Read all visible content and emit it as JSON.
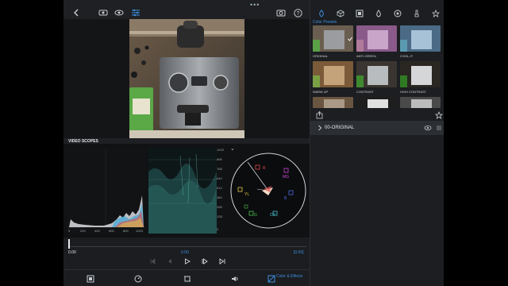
{
  "window": {
    "dots": "•••"
  },
  "toolbar": {
    "back_icon": "chevron-left-icon",
    "icons": [
      "viewer-icon",
      "eye-icon",
      "sliders-icon"
    ],
    "right_icons": [
      "camera-icon",
      "help-icon"
    ]
  },
  "scopes": {
    "label": "VIDEO SCOPES",
    "histogram_axis": [
      "0",
      "200",
      "400",
      "600",
      "800",
      "1023"
    ],
    "waveform_scale": [
      "1023",
      "896",
      "768",
      "640",
      "512",
      "384",
      "256",
      "128",
      "0"
    ],
    "vectorscope_targets": [
      "R",
      "MG",
      "B",
      "CY",
      "G",
      "YL"
    ]
  },
  "timeline": {
    "start_time": "0.00",
    "current_time": "0.00",
    "duration": "[0.00]"
  },
  "bottom_bar": {
    "color_effects_label": "Color & Effects"
  },
  "color_panel": {
    "section_title": "Color Presets",
    "presets": [
      {
        "label": "ORIGINAL",
        "selected": true
      },
      {
        "label": "ANTI-GREEN",
        "selected": false
      },
      {
        "label": "COOL-IT",
        "selected": false
      },
      {
        "label": "WARM UP",
        "selected": false
      },
      {
        "label": "CONTRAST",
        "selected": false
      },
      {
        "label": "HIGH CONTRAST",
        "selected": false
      },
      {
        "label": "",
        "selected": false
      },
      {
        "label": "",
        "selected": false
      },
      {
        "label": "",
        "selected": false
      }
    ],
    "group_label": "00-ORIGINAL"
  },
  "colors": {
    "accent": "#3d8fe0",
    "background": "#1e2023",
    "scope_bg": "#111214"
  }
}
